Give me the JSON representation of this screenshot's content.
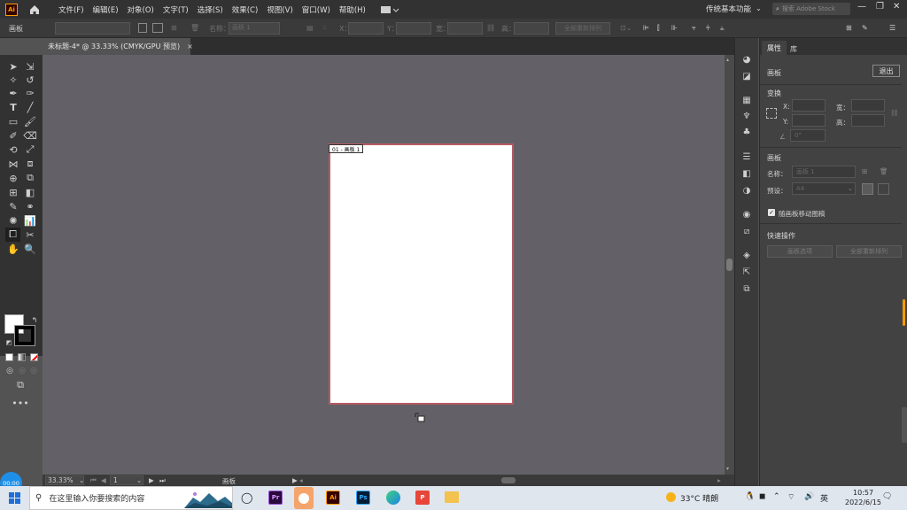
{
  "menubar": {
    "logo": "Ai",
    "items": [
      "文件(F)",
      "编辑(E)",
      "对象(O)",
      "文字(T)",
      "选择(S)",
      "效果(C)",
      "视图(V)",
      "窗口(W)",
      "帮助(H)"
    ],
    "workspace": "传统基本功能",
    "search_placeholder": "搜索 Adobe Stock"
  },
  "controlbar": {
    "artboard_label": "画板",
    "name_label": "名称：",
    "name_value": "画板 1",
    "x_label": "X：",
    "y_label": "Y：",
    "w_label": "宽：",
    "h_label": "高：",
    "rearrange": "全部重新排列"
  },
  "document": {
    "tab_title": "未标题-4* @ 33.33% (CMYK/GPU 预览)",
    "tab_close": "×",
    "artboard_label": "01 - 画板 1"
  },
  "statusbar": {
    "zoom": "33.33%",
    "page": "1",
    "tool": "画板"
  },
  "panel": {
    "tab_properties": "属性",
    "tab_layers": "库",
    "section_artboard_top": "画板",
    "exit_button": "退出",
    "section_transform": "变换",
    "x_label": "X:",
    "y_label": "Y:",
    "w_label": "宽：",
    "h_label": "高：",
    "angle_value": "0°",
    "section_artboard": "画板",
    "name_label": "名称：",
    "name_value": "画板 1",
    "preset_label": "预设：",
    "preset_value": "A4",
    "move_with_artboard": "随画板移动图稿",
    "section_quick_actions": "快速操作",
    "artboard_options_btn": "画板选项",
    "rearrange_all_btn": "全部重新排列"
  },
  "taskbar": {
    "search_placeholder": "在这里输入你要搜索的内容",
    "weather": "33°C 晴朗",
    "lang": "英",
    "time": "10:57",
    "date": "2022/6/15",
    "apps": [
      "Pr",
      "Ai",
      "Ps",
      "P"
    ]
  },
  "timer": {
    "value": "00:00"
  },
  "colors": {
    "canvas": "#636167",
    "artboard_border": "#b75a63",
    "panel_bg": "#424242",
    "toolbar_bg": "#323232",
    "accent": "#ff9a00",
    "taskbar_bg": "#dfe6ee"
  }
}
